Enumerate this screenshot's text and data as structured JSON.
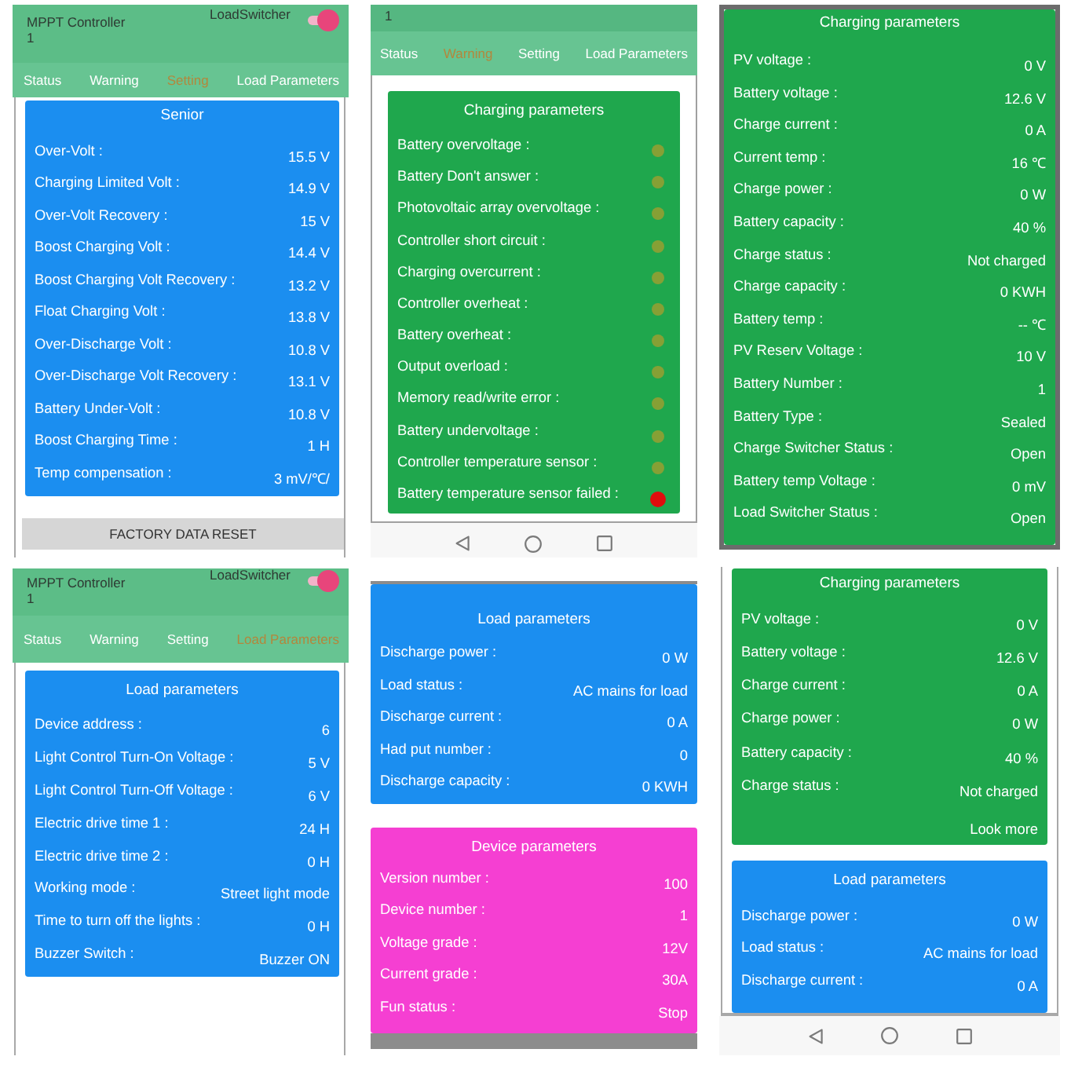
{
  "screens": [
    {
      "header": {
        "title": "MPPT Controller",
        "subtitle": "1",
        "switch_label": "LoadSwitcher",
        "switch_on": true
      },
      "tabs": [
        {
          "label": "Status",
          "selected": false
        },
        {
          "label": "Warning",
          "selected": false
        },
        {
          "label": "Setting",
          "selected": true
        },
        {
          "label": "Load Parameters",
          "selected": false
        }
      ],
      "cards": [
        {
          "kind": "readings",
          "title": "Senior",
          "color": "#1b8ef0",
          "rows": [
            {
              "label": "Over-Volt :",
              "value": "15.5 V"
            },
            {
              "label": "Charging Limited Volt :",
              "value": "14.9 V"
            },
            {
              "label": "Over-Volt Recovery :",
              "value": "15 V"
            },
            {
              "label": "Boost Charging Volt :",
              "value": "14.4 V"
            },
            {
              "label": "Boost Charging Volt Recovery :",
              "value": "13.2 V"
            },
            {
              "label": "Float Charging Volt :",
              "value": "13.8 V"
            },
            {
              "label": "Over-Discharge Volt :",
              "value": "10.8 V"
            },
            {
              "label": "Over-Discharge Volt Recovery :",
              "value": "13.1 V"
            },
            {
              "label": "Battery Under-Volt :",
              "value": "10.8 V"
            },
            {
              "label": "Boost Charging Time :",
              "value": "1 H"
            },
            {
              "label": "Temp compensation :",
              "value": "3 mV/℃/"
            }
          ]
        }
      ],
      "button": "FACTORY DATA RESET"
    },
    {
      "header": {
        "subtitle": "1"
      },
      "tabs": [
        {
          "label": "Status",
          "selected": false
        },
        {
          "label": "Warning",
          "selected": true
        },
        {
          "label": "Setting",
          "selected": false
        },
        {
          "label": "Load Parameters",
          "selected": false
        }
      ],
      "cards": [
        {
          "kind": "alarms",
          "title": "Charging parameters",
          "color": "#1fa74d",
          "rows": [
            {
              "label": "Battery overvoltage :",
              "alarm": false
            },
            {
              "label": "Battery Don't answer :",
              "alarm": false
            },
            {
              "label": "Photovoltaic array overvoltage :",
              "alarm": false
            },
            {
              "label": "Controller short circuit :",
              "alarm": false
            },
            {
              "label": "Charging overcurrent :",
              "alarm": false
            },
            {
              "label": "Controller overheat :",
              "alarm": false
            },
            {
              "label": "Battery overheat :",
              "alarm": false
            },
            {
              "label": "Output overload :",
              "alarm": false
            },
            {
              "label": "Memory read/write error :",
              "alarm": false
            },
            {
              "label": "Battery undervoltage :",
              "alarm": false
            },
            {
              "label": "Controller temperature sensor :",
              "alarm": false
            },
            {
              "label": "Battery temperature sensor failed :",
              "alarm": true
            }
          ]
        }
      ],
      "nav_bar": true
    },
    {
      "cards": [
        {
          "kind": "readings",
          "title": "Charging parameters",
          "color": "#1fa74d",
          "rows": [
            {
              "label": "PV voltage :",
              "value": "0 V"
            },
            {
              "label": "Battery voltage :",
              "value": "12.6 V"
            },
            {
              "label": "Charge current :",
              "value": "0 A"
            },
            {
              "label": "Current temp :",
              "value": "16 ℃"
            },
            {
              "label": "Charge power :",
              "value": "0 W"
            },
            {
              "label": "Battery capacity :",
              "value": "40 %"
            },
            {
              "label": "Charge status :",
              "value": "Not charged"
            },
            {
              "label": "Charge capacity :",
              "value": "0 KWH"
            },
            {
              "label": "Battery temp :",
              "value": "-- ℃"
            },
            {
              "label": "PV Reserv Voltage :",
              "value": "10 V"
            },
            {
              "label": "Battery Number :",
              "value": "1"
            },
            {
              "label": "Battery Type :",
              "value": "Sealed"
            },
            {
              "label": "Charge Switcher Status :",
              "value": "Open"
            },
            {
              "label": "Battery temp Voltage :",
              "value": "0 mV"
            },
            {
              "label": "Load Switcher Status :",
              "value": "Open"
            }
          ]
        }
      ]
    },
    {
      "header": {
        "title": "MPPT Controller",
        "subtitle": "1",
        "switch_label": "LoadSwitcher",
        "switch_on": true
      },
      "tabs": [
        {
          "label": "Status",
          "selected": false
        },
        {
          "label": "Warning",
          "selected": false
        },
        {
          "label": "Setting",
          "selected": false
        },
        {
          "label": "Load Parameters",
          "selected": true
        }
      ],
      "cards": [
        {
          "kind": "readings",
          "title": "Load parameters",
          "color": "#1b8ef0",
          "rows": [
            {
              "label": "Device address :",
              "value": "6"
            },
            {
              "label": "Light Control Turn-On Voltage :",
              "value": "5 V"
            },
            {
              "label": "Light Control Turn-Off Voltage :",
              "value": "6 V"
            },
            {
              "label": "Electric drive time 1 :",
              "value": "24 H"
            },
            {
              "label": "Electric drive time 2 :",
              "value": "0 H"
            },
            {
              "label": "Working mode :",
              "value": "Street light mode"
            },
            {
              "label": "Time to turn off the lights :",
              "value": "0 H"
            },
            {
              "label": "Buzzer Switch :",
              "value": "Buzzer ON"
            }
          ]
        }
      ]
    },
    {
      "cards": [
        {
          "kind": "readings",
          "title": "Load parameters",
          "color": "#1b8ef0",
          "rows": [
            {
              "label": "Discharge power :",
              "value": "0 W"
            },
            {
              "label": "Load status :",
              "value": "AC mains for load"
            },
            {
              "label": "Discharge current :",
              "value": "0 A"
            },
            {
              "label": "Had put number :",
              "value": "0"
            },
            {
              "label": "Discharge capacity :",
              "value": "0 KWH"
            }
          ]
        },
        {
          "kind": "readings",
          "title": "Device parameters",
          "color": "#f53fd2",
          "rows": [
            {
              "label": "Version number :",
              "value": "100"
            },
            {
              "label": "Device number :",
              "value": "1"
            },
            {
              "label": "Voltage grade :",
              "value": "12V"
            },
            {
              "label": "Current grade :",
              "value": "30A"
            },
            {
              "label": "Fun status :",
              "value": "Stop"
            }
          ]
        }
      ]
    },
    {
      "cards": [
        {
          "kind": "readings",
          "title": "Charging parameters",
          "color": "#1fa74d",
          "rows": [
            {
              "label": "PV voltage :",
              "value": "0 V"
            },
            {
              "label": "Battery voltage :",
              "value": "12.6 V"
            },
            {
              "label": "Charge current :",
              "value": "0 A"
            },
            {
              "label": "Charge power :",
              "value": "0 W"
            },
            {
              "label": "Battery capacity :",
              "value": "40 %"
            },
            {
              "label": "Charge status :",
              "value": "Not charged"
            }
          ],
          "link": "Look more"
        },
        {
          "kind": "readings",
          "title": "Load parameters",
          "color": "#1b8ef0",
          "rows": [
            {
              "label": "Discharge power :",
              "value": "0 W"
            },
            {
              "label": "Load status :",
              "value": "AC mains for load"
            },
            {
              "label": "Discharge current :",
              "value": "0 A"
            }
          ]
        }
      ],
      "nav_bar": true
    }
  ]
}
